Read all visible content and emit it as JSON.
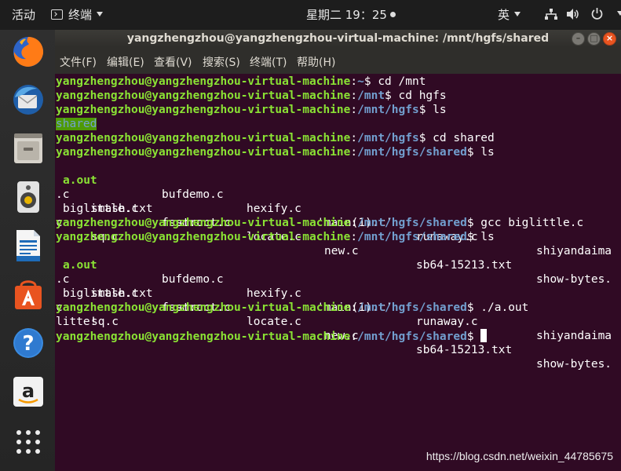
{
  "topbar": {
    "activities": "活动",
    "app_menu": "终端",
    "clock": "星期二 19：25",
    "input_method": "英"
  },
  "window": {
    "title": "yangzhengzhou@yangzhengzhou-virtual-machine: /mnt/hgfs/shared",
    "buttons": {
      "minimize": "–",
      "maximize": "□",
      "close": "×"
    }
  },
  "menu": {
    "file": "文件(F)",
    "edit": "编辑(E)",
    "view": "查看(V)",
    "search": "搜索(S)",
    "terminal": "终端(T)",
    "help": "帮助(H)"
  },
  "dock": [
    {
      "name": "firefox-icon"
    },
    {
      "name": "thunderbird-icon"
    },
    {
      "name": "files-icon"
    },
    {
      "name": "rhythmbox-icon"
    },
    {
      "name": "writer-icon"
    },
    {
      "name": "software-center-icon"
    },
    {
      "name": "help-icon"
    },
    {
      "name": "amazon-icon"
    },
    {
      "name": "show-apps-icon"
    }
  ],
  "terminal": {
    "user": "yangzhengzhou@yangzhengzhou-virtual-machine",
    "lines": {
      "l0_path": "~",
      "l0_cmd": " cd /mnt",
      "l1_path": "/mnt",
      "l1_cmd": " cd hgfs",
      "l2_path": "/mnt/hgfs",
      "l2_cmd": " ls",
      "l3_out": "shared",
      "l4_path": "/mnt/hgfs",
      "l4_cmd": " cd shared",
      "l5_path": "/mnt/hgfs/shared",
      "l5_cmd": " ls",
      "l10_path": "/mnt/hgfs/shared",
      "l10_cmd": " gcc biglittle.c",
      "l11_path": "/mnt/hgfs/shared",
      "l11_cmd": " ls",
      "l16_path": "/mnt/hgfs/shared",
      "l16_cmd": " ./a.out",
      "l17_out": "litte!",
      "l18_path": "/mnt/hgfs/shared",
      "l18_cmd": " "
    },
    "ls1": {
      "r1": [
        "a.out",
        "bufdemo.c",
        "hexify.c",
        "'main(1).c'",
        "runaway.c",
        "shiyandaima"
      ],
      "r2": [
        ".c",
        "smash.txt",
        "struct.c"
      ],
      "r3": [
        "biglittle.c",
        "fsum.c",
        "locate.c",
        "new.c",
        "sb64-15213.txt",
        "show-bytes."
      ],
      "r4": [
        "c",
        "sq.c"
      ]
    },
    "ls2": {
      "r1": [
        "a.out",
        "bufdemo.c",
        "hexify.c",
        "'main(1).c'",
        "runaway.c",
        "shiyandaima"
      ],
      "r2": [
        ".c",
        "smash.txt",
        "struct.c"
      ],
      "r3": [
        "biglittle.c",
        "fsum.c",
        "locate.c",
        "new.c",
        "sb64-15213.txt",
        "show-bytes."
      ],
      "r4": [
        "c",
        "sq.c"
      ]
    }
  },
  "watermark": "https://blog.csdn.net/weixin_44785675",
  "colors": {
    "terminal_bg": "#300a24",
    "prompt_user": "#8ae234",
    "prompt_path": "#729fcf",
    "dir_highlight": "#4e9a06",
    "accent": "#e95420"
  }
}
